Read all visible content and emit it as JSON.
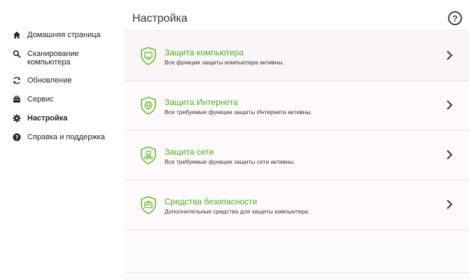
{
  "sidebar": {
    "items": [
      {
        "label": "Домашняя страница",
        "icon": "home-icon"
      },
      {
        "label": "Сканирование\nкомпьютера",
        "icon": "search-icon"
      },
      {
        "label": "Обновление",
        "icon": "refresh-icon"
      },
      {
        "label": "Сервис",
        "icon": "briefcase-icon"
      },
      {
        "label": "Настройка",
        "icon": "gear-icon",
        "active": true
      },
      {
        "label": "Справка и поддержка",
        "icon": "help-circle-icon"
      }
    ]
  },
  "header": {
    "title": "Настройка",
    "help_label": "?"
  },
  "cards": [
    {
      "title": "Защита компьютера",
      "description": "Все функции защиты компьютера активны.",
      "icon": "shield-monitor-icon"
    },
    {
      "title": "Защита Интернета",
      "description": "Все требуемые функции защиты Интернета активны.",
      "icon": "shield-globe-icon"
    },
    {
      "title": "Защита сети",
      "description": "Все требуемые функции защиты сети активны.",
      "icon": "shield-network-icon"
    },
    {
      "title": "Средства безопасности",
      "description": "Дополнительные средства для защиты компьютера.",
      "icon": "shield-toolbox-icon"
    }
  ],
  "colors": {
    "accent_green": "#56a821",
    "shield_green": "#7cc04a"
  }
}
